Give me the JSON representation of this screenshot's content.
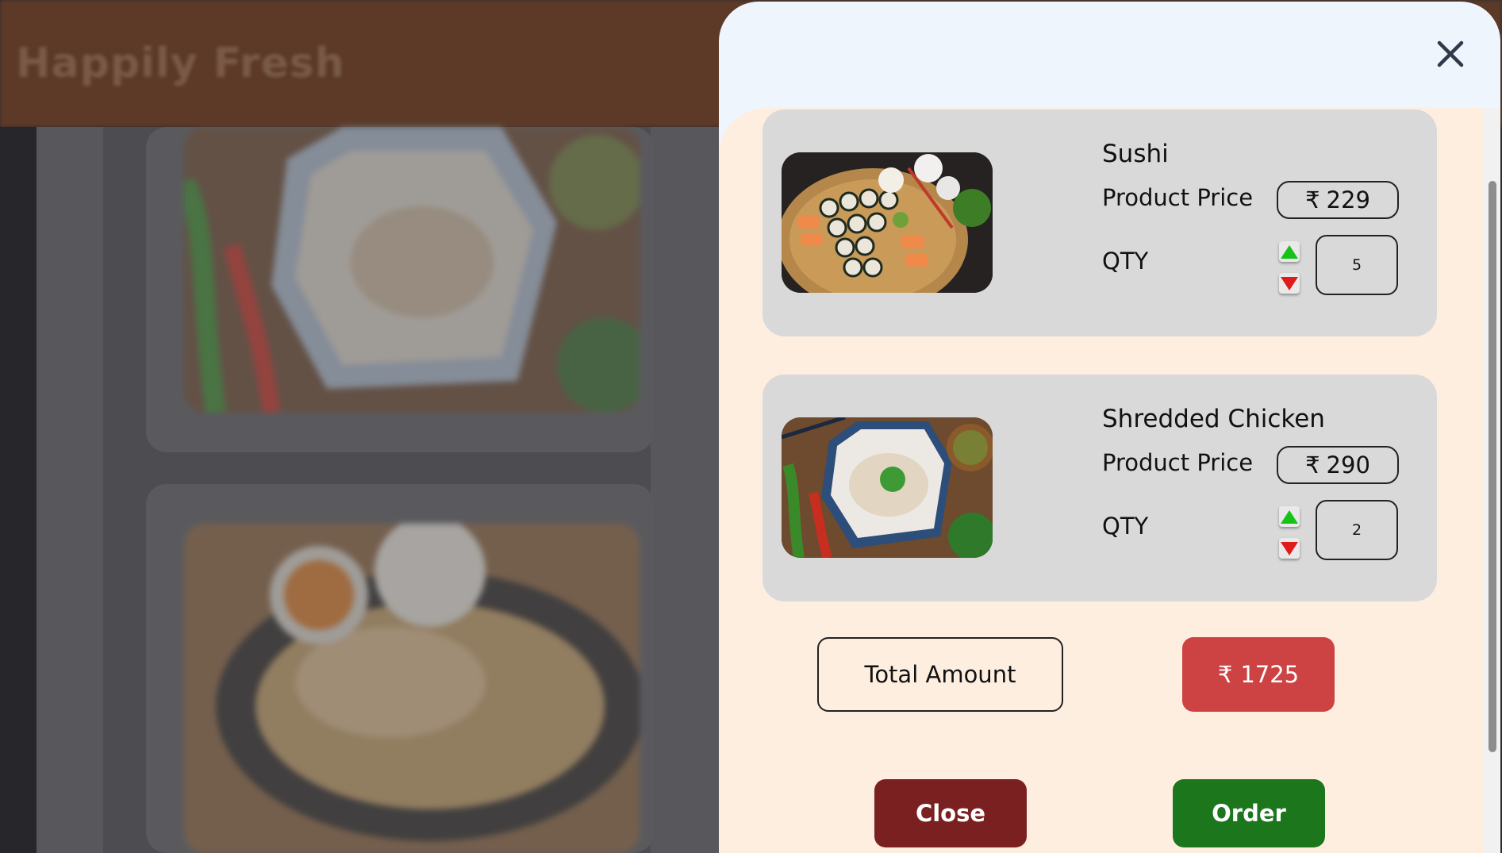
{
  "background_page": {
    "brand": "Happily Fresh"
  },
  "modal": {
    "close_icon": "close-icon",
    "items": [
      {
        "name": "Sushi",
        "price_label": "Product Price",
        "currency": "₹",
        "price": "229",
        "qty_label": "QTY",
        "qty": "5"
      },
      {
        "name": "Shredded Chicken",
        "price_label": "Product Price",
        "currency": "₹",
        "price": "290",
        "qty_label": "QTY",
        "qty": "2"
      }
    ],
    "total_label": "Total Amount",
    "total_currency": "₹",
    "total_value": "1725",
    "close_button": "Close",
    "order_button": "Order"
  },
  "colors": {
    "modal_bg": "#eef5fd",
    "body_bg": "#feeee0",
    "card_bg": "#d9d9d9",
    "total_bg": "#cd4343",
    "close_bg": "#7b2020",
    "order_bg": "#1c761c",
    "qty_up": "#15c215",
    "qty_down": "#e01b1b"
  }
}
